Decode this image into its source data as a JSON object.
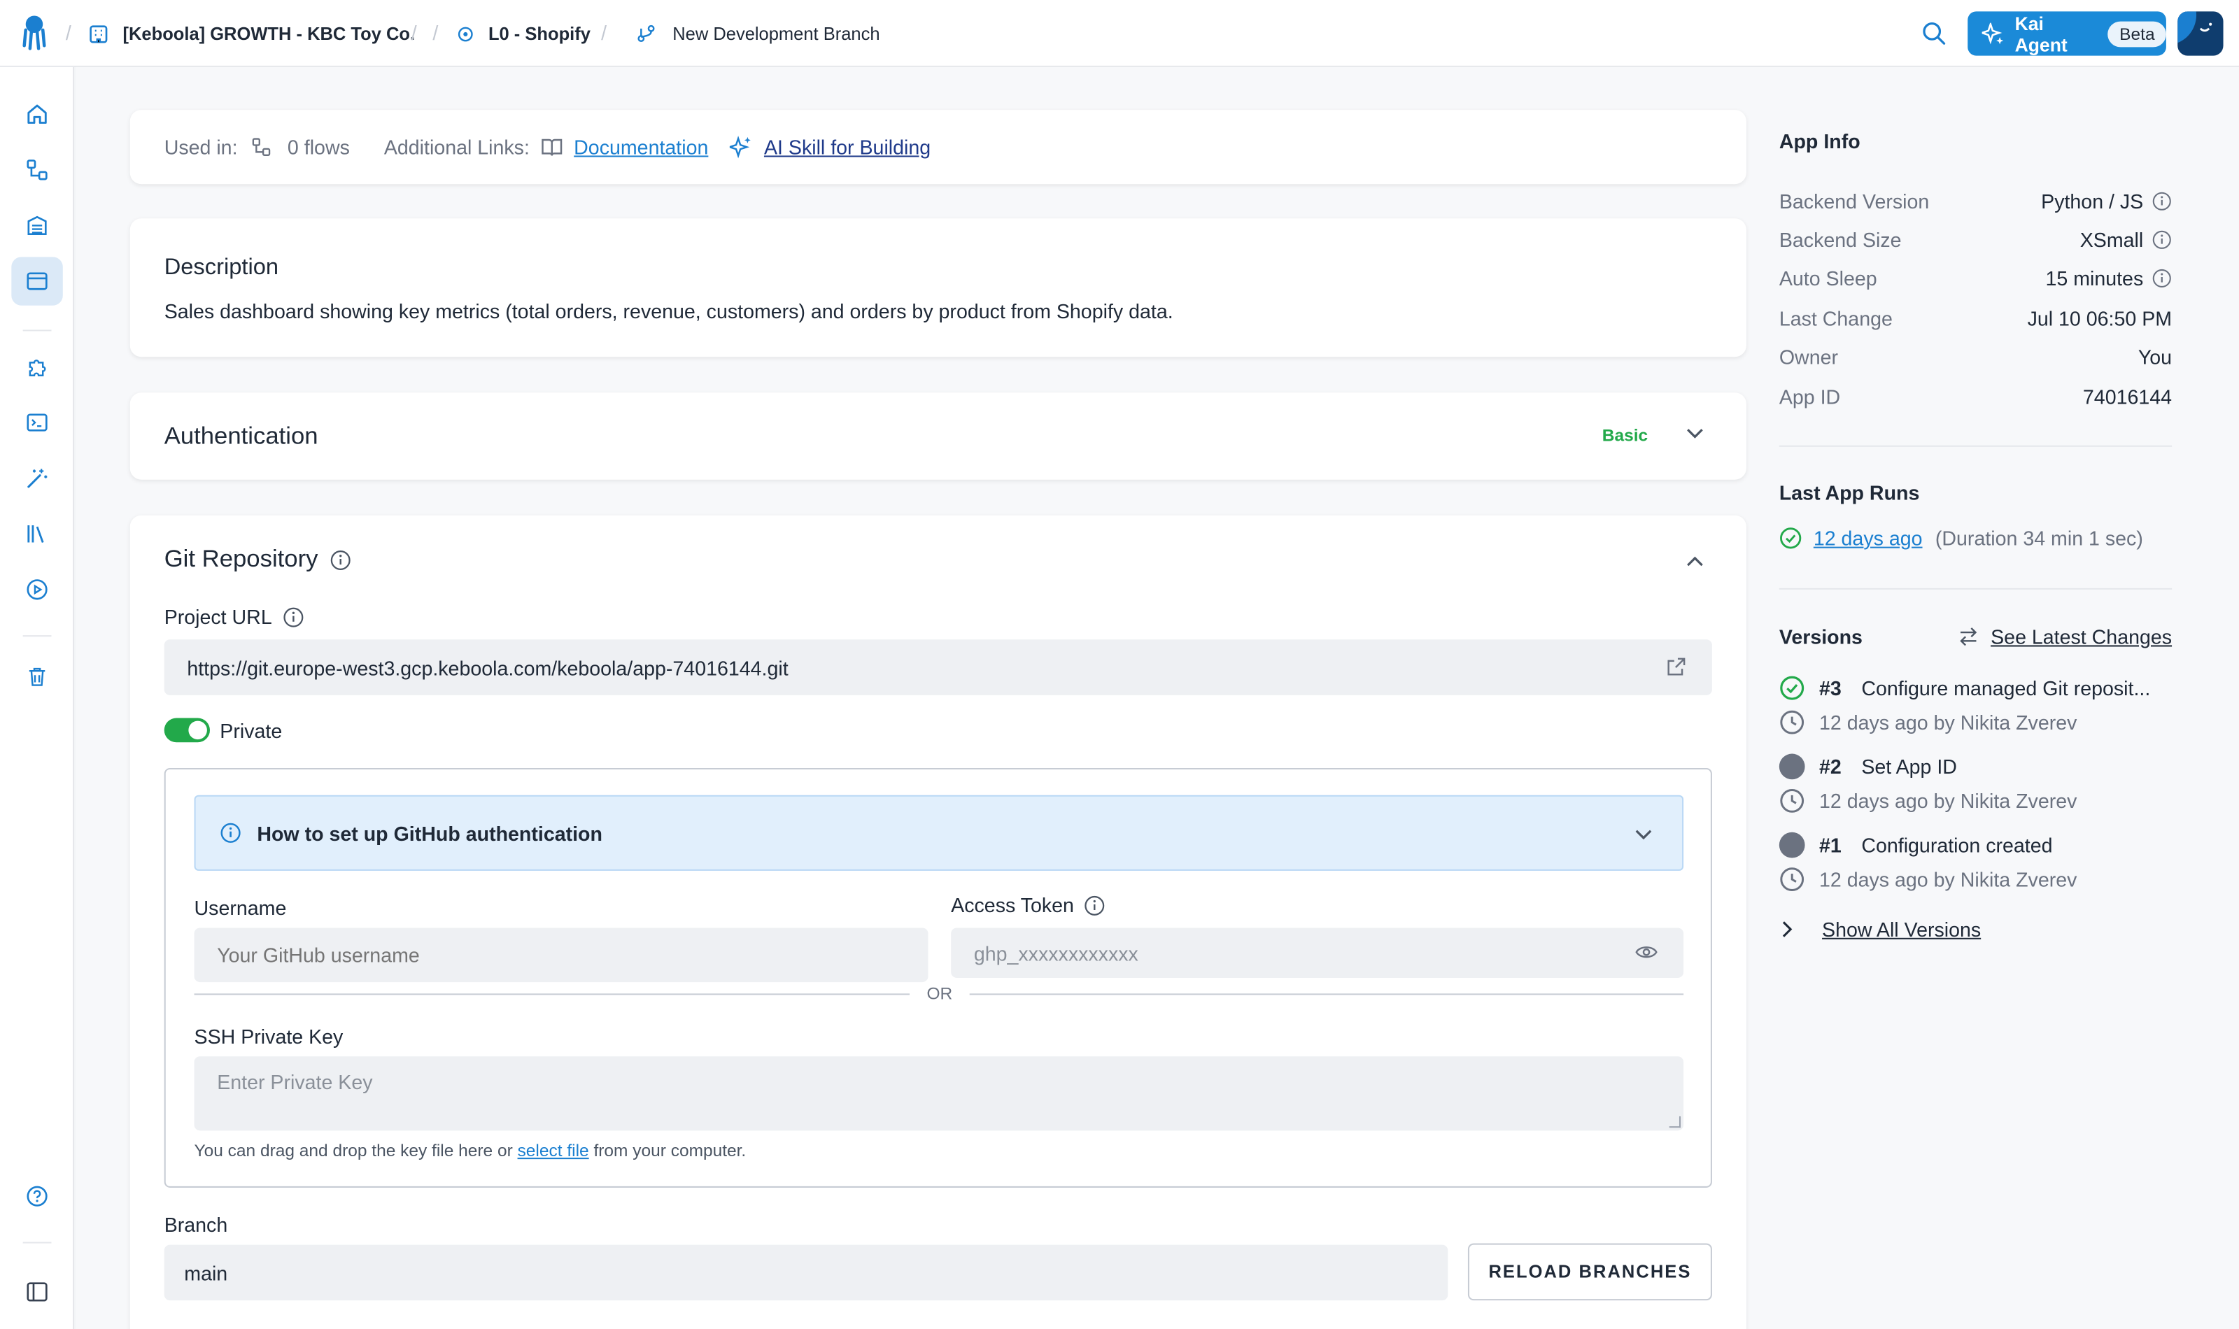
{
  "topbar": {
    "breadcrumbs": [
      {
        "label": "[Keboola] GROWTH - KBC Toy Co."
      },
      {
        "label": "L0 - Shopify"
      },
      {
        "label": "New Development Branch"
      }
    ],
    "kai_label": "Kai Agent",
    "kai_badge": "Beta"
  },
  "info_bar": {
    "used_in_label": "Used in:",
    "flows": "0 flows",
    "additional_links_label": "Additional Links:",
    "documentation": "Documentation",
    "ai_skill": "AI Skill for Building"
  },
  "description": {
    "title": "Description",
    "text": "Sales dashboard showing key metrics (total orders, revenue, customers) and orders by product from Shopify data."
  },
  "authentication": {
    "title": "Authentication",
    "badge": "Basic"
  },
  "git": {
    "title": "Git Repository",
    "project_url_label": "Project URL",
    "project_url": "https://git.europe-west3.gcp.keboola.com/keboola/app-74016144.git",
    "private_label": "Private",
    "private_on": true,
    "howto": "How to set up GitHub authentication",
    "username_label": "Username",
    "username_placeholder": "Your GitHub username",
    "token_label": "Access Token",
    "token_placeholder": "ghp_xxxxxxxxxxxx",
    "or": "OR",
    "ssh_label": "SSH Private Key",
    "ssh_placeholder": "Enter Private Key",
    "hint_before": "You can drag and drop the key file here or ",
    "hint_link": "select file",
    "hint_after": " from your computer.",
    "branch_label": "Branch",
    "branch_value": "main",
    "reload_button": "RELOAD BRANCHES"
  },
  "app_info": {
    "title": "App Info",
    "rows": [
      {
        "key": "Backend Version",
        "value": "Python / JS"
      },
      {
        "key": "Backend Size",
        "value": "XSmall"
      },
      {
        "key": "Auto Sleep",
        "value": "15 minutes"
      },
      {
        "key": "Last Change",
        "value": "Jul 10 06:50 PM"
      },
      {
        "key": "Owner",
        "value": "You"
      },
      {
        "key": "App ID",
        "value": "74016144"
      }
    ]
  },
  "last_runs": {
    "title": "Last App Runs",
    "link": "12 days ago",
    "duration": "(Duration 34 min 1 sec)"
  },
  "versions": {
    "title": "Versions",
    "see_latest": "See Latest Changes",
    "items": [
      {
        "num": "#3",
        "title": "Configure managed Git reposit...",
        "meta": "12 days ago by Nikita Zverev"
      },
      {
        "num": "#2",
        "title": "Set App ID",
        "meta": "12 days ago by Nikita Zverev"
      },
      {
        "num": "#1",
        "title": "Configuration created",
        "meta": "12 days ago by Nikita Zverev"
      }
    ],
    "show_all": "Show All Versions"
  },
  "colors": {
    "accent": "#1b7fd0",
    "success": "#22a94a",
    "info_bg": "#e1effc"
  }
}
